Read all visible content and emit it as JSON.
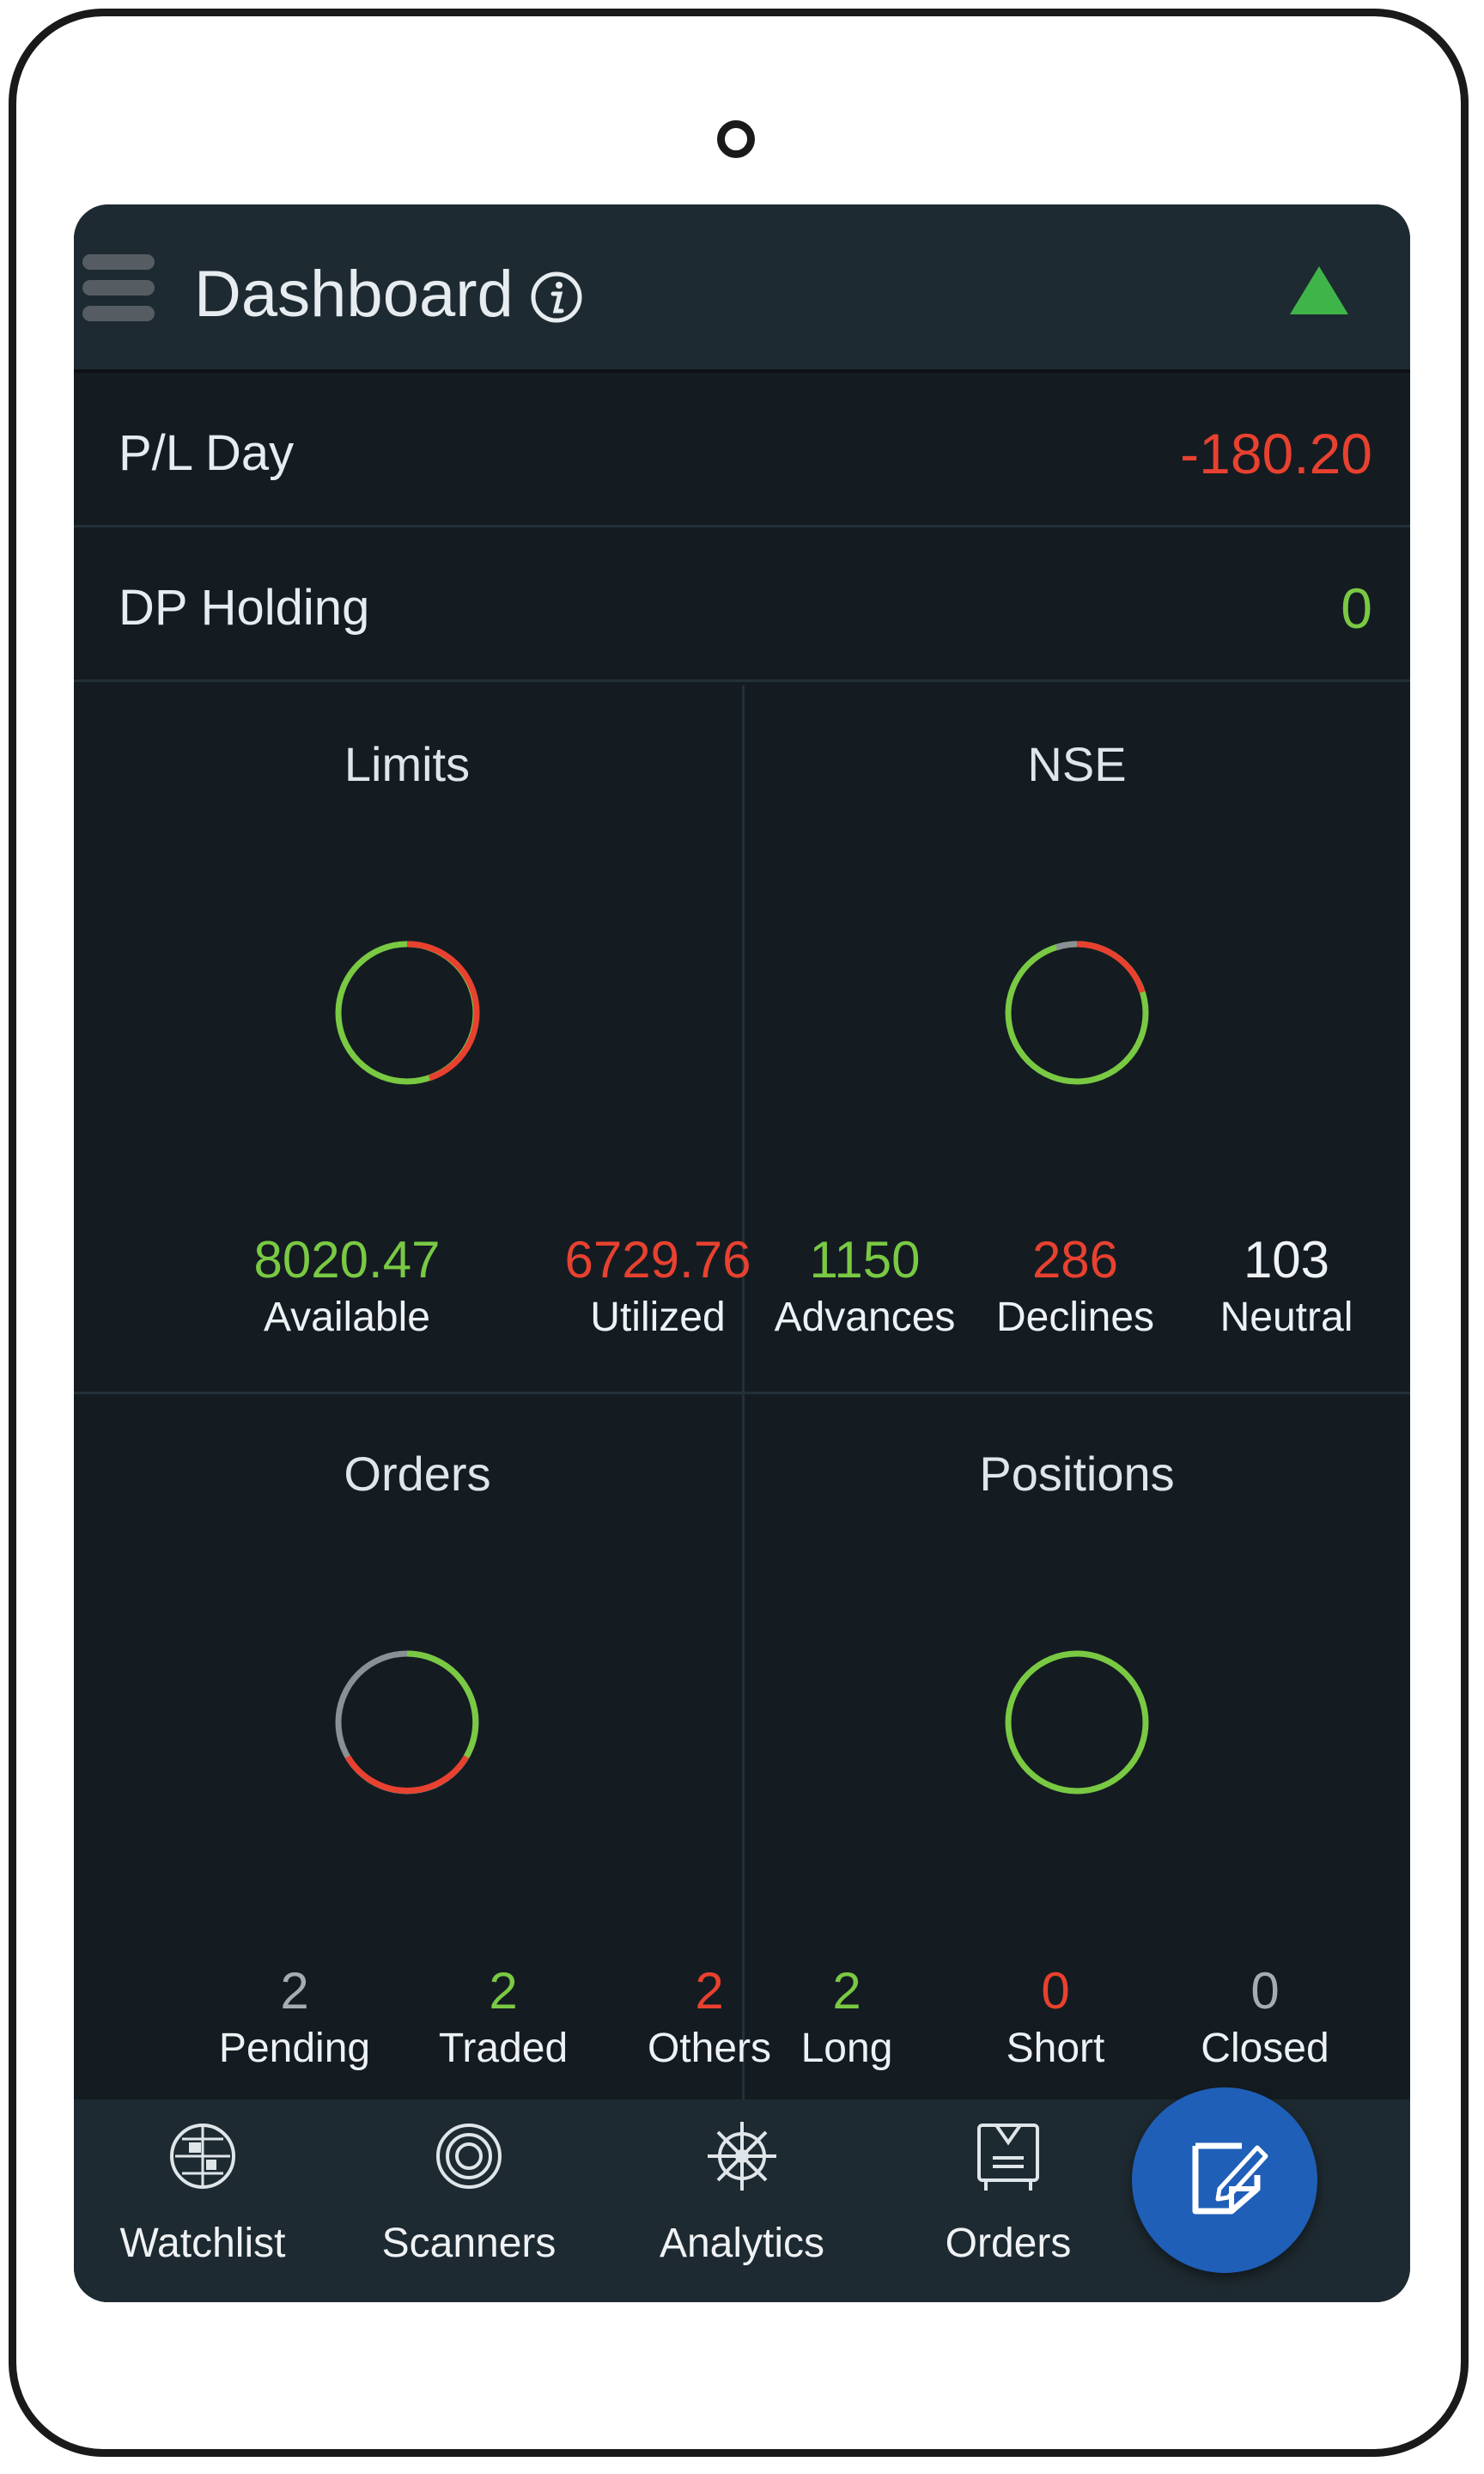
{
  "header": {
    "title": "Dashboard"
  },
  "summary": {
    "pl_day": {
      "label": "P/L Day",
      "value": "-180.20"
    },
    "dp_holding": {
      "label": "DP Holding",
      "value": "0"
    }
  },
  "limits": {
    "title": "Limits",
    "available": {
      "value": "8020.47",
      "label": "Available"
    },
    "utilized": {
      "value": "6729.76",
      "label": "Utilized"
    }
  },
  "nse": {
    "title": "NSE",
    "advances": {
      "value": "1150",
      "label": "Advances"
    },
    "declines": {
      "value": "286",
      "label": "Declines"
    },
    "neutral": {
      "value": "103",
      "label": "Neutral"
    }
  },
  "orders": {
    "title": "Orders",
    "pending": {
      "value": "2",
      "label": "Pending"
    },
    "traded": {
      "value": "2",
      "label": "Traded"
    },
    "others": {
      "value": "2",
      "label": "Others"
    }
  },
  "positions": {
    "title": "Positions",
    "long": {
      "value": "2",
      "label": "Long"
    },
    "short": {
      "value": "0",
      "label": "Short"
    },
    "closed": {
      "value": "0",
      "label": "Closed"
    }
  },
  "nav": {
    "watchlist": "Watchlist",
    "scanners": "Scanners",
    "analytics": "Analytics",
    "orders": "Orders"
  },
  "colors": {
    "positive": "#7ac943",
    "negative": "#e8412f",
    "neutral": "#8a9194",
    "fab": "#1f5fb8"
  },
  "icons": {
    "menu": "hamburger-menu-icon",
    "info": "info-icon",
    "market_trend": "up-triangle-icon",
    "watchlist": "globe-icon",
    "scanners": "target-icon",
    "analytics": "wheel-icon",
    "orders": "clipboard-icon",
    "fab": "edit-note-icon"
  }
}
